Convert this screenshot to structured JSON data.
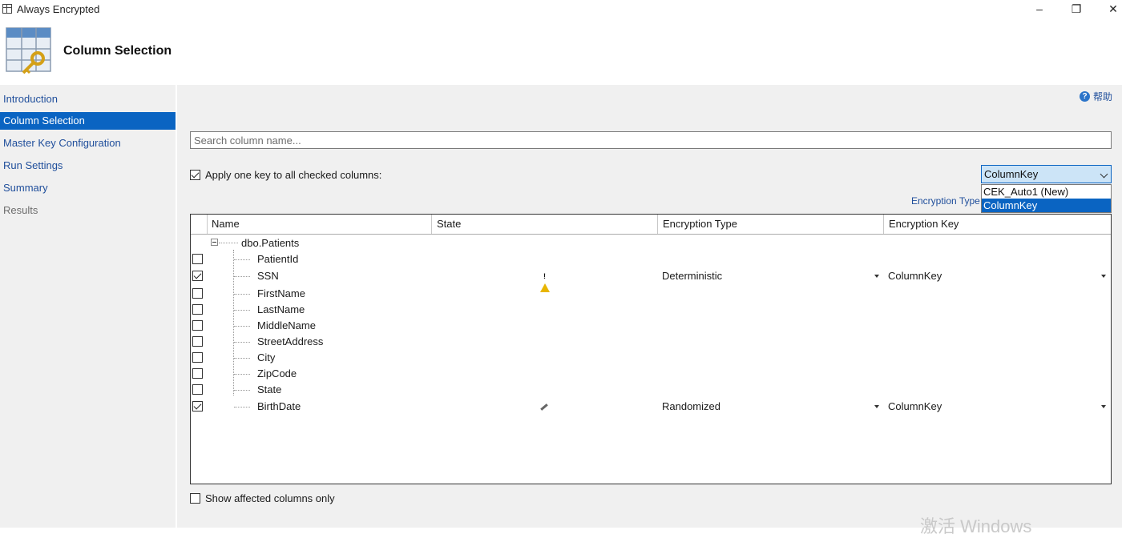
{
  "window": {
    "title": "Always Encrypted",
    "min_glyph": "–",
    "max_glyph": "❐",
    "close_glyph": "✕"
  },
  "header": {
    "title": "Column Selection"
  },
  "sidebar": {
    "items": [
      {
        "label": "Introduction"
      },
      {
        "label": "Column Selection"
      },
      {
        "label": "Master Key Configuration"
      },
      {
        "label": "Run Settings"
      },
      {
        "label": "Summary"
      },
      {
        "label": "Results"
      }
    ]
  },
  "help": {
    "label": "帮助",
    "icon_glyph": "?"
  },
  "search": {
    "placeholder": "Search column name..."
  },
  "apply_one_key": {
    "label": "Apply one key to all checked columns:",
    "checked": true
  },
  "key_select": {
    "value": "ColumnKey",
    "options": [
      "CEK_Auto1 (New)",
      "ColumnKey"
    ]
  },
  "encryption_type_tip": "Encryption Type",
  "grid": {
    "columns": [
      "Name",
      "State",
      "Encryption Type",
      "Encryption Key"
    ],
    "table_name": "dbo.Patients",
    "rows": [
      {
        "name": "PatientId",
        "checked": false,
        "state": "",
        "enc_type": "",
        "enc_key": ""
      },
      {
        "name": "SSN",
        "checked": true,
        "state": "warning-icon",
        "enc_type": "Deterministic",
        "enc_key": "ColumnKey"
      },
      {
        "name": "FirstName",
        "checked": false,
        "state": "",
        "enc_type": "",
        "enc_key": ""
      },
      {
        "name": "LastName",
        "checked": false,
        "state": "",
        "enc_type": "",
        "enc_key": ""
      },
      {
        "name": "MiddleName",
        "checked": false,
        "state": "",
        "enc_type": "",
        "enc_key": ""
      },
      {
        "name": "StreetAddress",
        "checked": false,
        "state": "",
        "enc_type": "",
        "enc_key": ""
      },
      {
        "name": "City",
        "checked": false,
        "state": "",
        "enc_type": "",
        "enc_key": ""
      },
      {
        "name": "ZipCode",
        "checked": false,
        "state": "",
        "enc_type": "",
        "enc_key": ""
      },
      {
        "name": "State",
        "checked": false,
        "state": "",
        "enc_type": "",
        "enc_key": ""
      },
      {
        "name": "BirthDate",
        "checked": true,
        "state": "pencil-icon",
        "enc_type": "Randomized",
        "enc_key": "ColumnKey"
      }
    ]
  },
  "show_affected": {
    "label": "Show affected columns only",
    "checked": false
  },
  "watermark": "激活 Windows",
  "colors": {
    "accent": "#0a64c2",
    "link": "#1f4e9b",
    "panel": "#f0f0f0",
    "warning": "#e8b500"
  }
}
